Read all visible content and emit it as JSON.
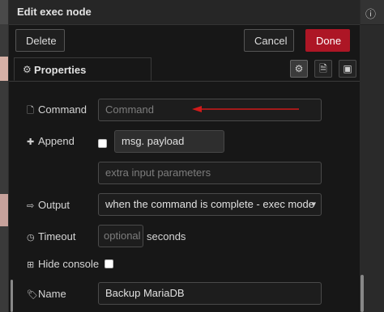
{
  "dialog": {
    "title": "Edit exec node",
    "buttons": {
      "delete": "Delete",
      "cancel": "Cancel",
      "done": "Done"
    },
    "tab": {
      "label": "Properties"
    }
  },
  "form": {
    "command": {
      "label": "Command",
      "placeholder": "Command"
    },
    "append": {
      "label": "Append",
      "checked": false,
      "prefix": "msg. payload",
      "extra_placeholder": "extra input parameters"
    },
    "output": {
      "label": "Output",
      "value": "when the command is complete - exec mode"
    },
    "timeout": {
      "label": "Timeout",
      "placeholder": "optional",
      "unit": "seconds"
    },
    "hide_console": {
      "label": "Hide console",
      "checked": false
    },
    "name": {
      "label": "Name",
      "value": "Backup MariaDB"
    }
  },
  "colors": {
    "done": "#ad1625",
    "annotation_arrow": "#d11a1a"
  }
}
